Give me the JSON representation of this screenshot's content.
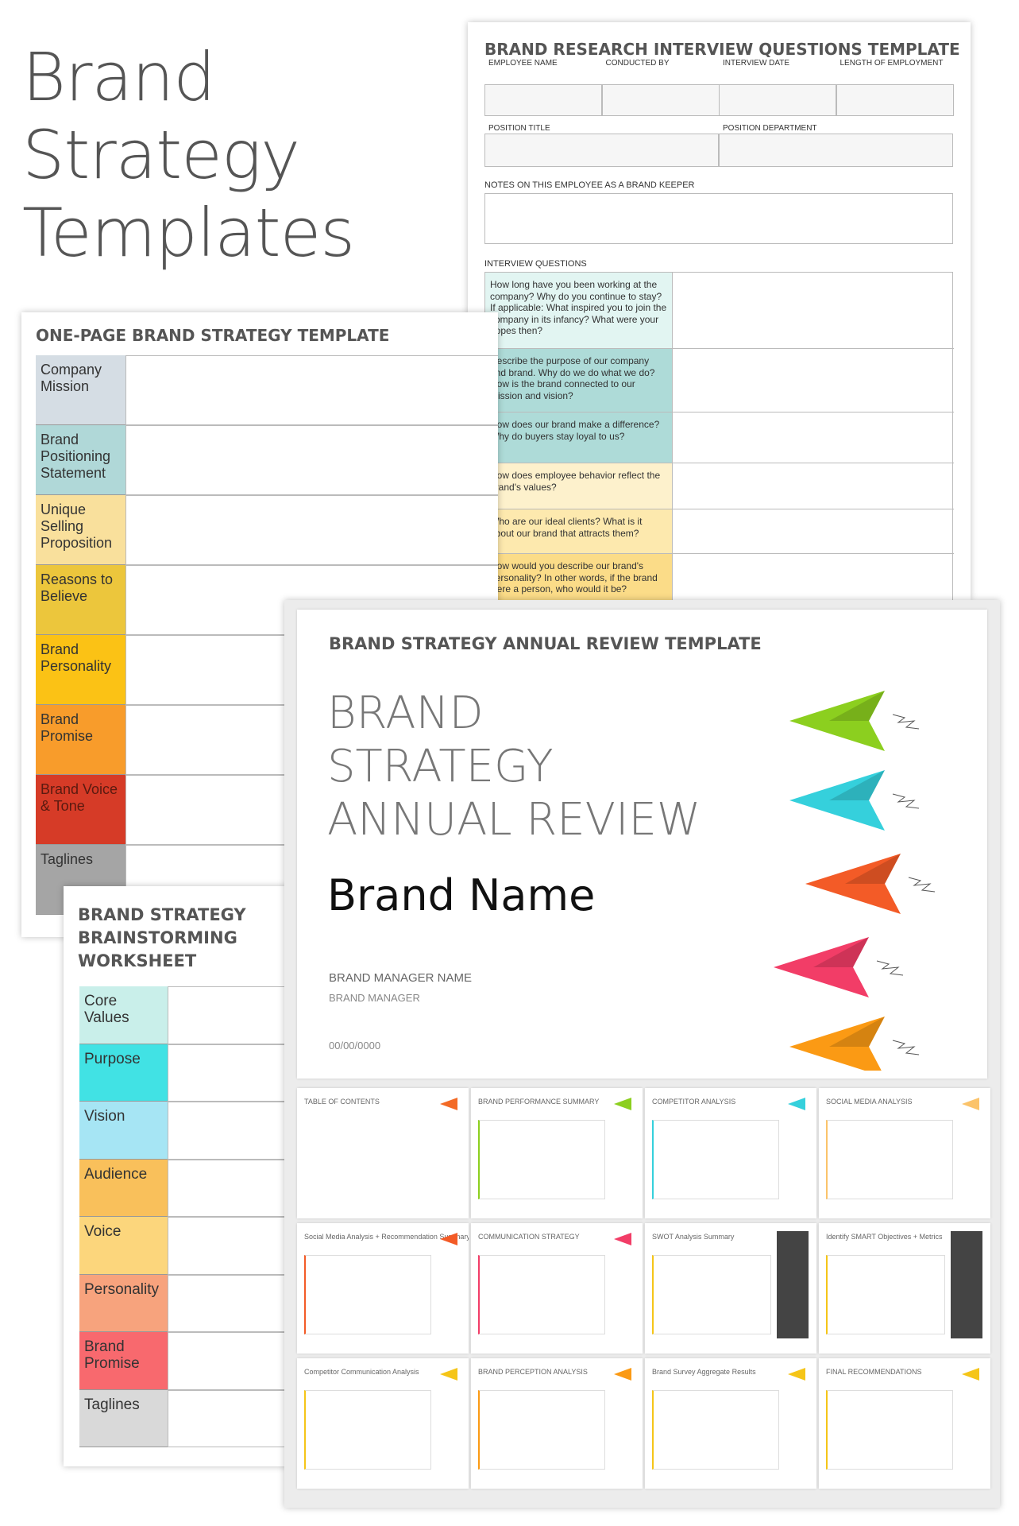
{
  "hero": {
    "line1": "Brand",
    "line2": "Strategy",
    "line3": "Templates"
  },
  "interview": {
    "title": "BRAND RESEARCH INTERVIEW QUESTIONS TEMPLATE",
    "fields1": [
      "EMPLOYEE NAME",
      "CONDUCTED BY",
      "INTERVIEW DATE",
      "LENGTH OF EMPLOYMENT"
    ],
    "fields2": [
      "POSITION TITLE",
      "POSITION DEPARTMENT"
    ],
    "notes_label": "NOTES ON THIS EMPLOYEE AS A BRAND KEEPER",
    "questions_label": "INTERVIEW QUESTIONS",
    "questions": [
      {
        "text": "How long have you been working at the company? Why do you continue to stay? If applicable: What inspired you to join the company in its infancy? What were your hopes then?",
        "color": "#e2f5f2"
      },
      {
        "text": "Describe the purpose of our company and brand. Why do we do what we do? How is the brand connected to our mission and vision?",
        "color": "#aedbd8"
      },
      {
        "text": "How does our brand make a difference? Why do buyers stay loyal to us?",
        "color": "#aedbd8"
      },
      {
        "text": "How does employee behavior reflect the brand's values?",
        "color": "#fdf1cc"
      },
      {
        "text": "Who are our ideal clients? What is it about our brand that attracts them?",
        "color": "#fde9ae"
      },
      {
        "text": "How would you describe our brand's personality? In other words, if the brand were a person, who would it be?",
        "color": "#fbdc88"
      }
    ]
  },
  "onepage": {
    "title": "ONE-PAGE BRAND STRATEGY TEMPLATE",
    "rows": [
      {
        "label": "Company Mission",
        "color": "#d5dde4"
      },
      {
        "label": "Brand Positioning Statement",
        "color": "#b0d8d8"
      },
      {
        "label": "Unique Selling Proposition",
        "color": "#f9e09c"
      },
      {
        "label": "Reasons to Believe",
        "color": "#ecc63c"
      },
      {
        "label": "Brand Personality",
        "color": "#fbc215"
      },
      {
        "label": "Brand Promise",
        "color": "#f89c2b"
      },
      {
        "label": "Brand Voice & Tone",
        "color": "#d63b27"
      },
      {
        "label": "Taglines",
        "color": "#a5a5a5"
      }
    ]
  },
  "brainstorm": {
    "title": "BRAND STRATEGY BRAINSTORMING WORKSHEET",
    "rows": [
      {
        "label": "Core Values",
        "color": "#c9efea"
      },
      {
        "label": "Purpose",
        "color": "#41e2e4"
      },
      {
        "label": "Vision",
        "color": "#a6e5f4"
      },
      {
        "label": "Audience",
        "color": "#f9c05b"
      },
      {
        "label": "Voice",
        "color": "#fcd67c"
      },
      {
        "label": "Personality",
        "color": "#f7a37d"
      },
      {
        "label": "Brand Promise",
        "color": "#f8696e"
      },
      {
        "label": "Taglines",
        "color": "#d9d9d9"
      }
    ]
  },
  "review": {
    "header": "BRAND STRATEGY ANNUAL REVIEW TEMPLATE",
    "big1": "BRAND",
    "big2": "STRATEGY",
    "big3": "ANNUAL REVIEW",
    "brand_name": "Brand Name",
    "manager_name": "BRAND MANAGER NAME",
    "manager_role": "BRAND MANAGER",
    "date": "00/00/0000",
    "plane_colors": [
      "#8ccf1f",
      "#35d0dc",
      "#f35b27",
      "#f23d67",
      "#fb9a14"
    ],
    "pages": [
      {
        "title": "TABLE OF CONTENTS",
        "accent": "#f36a25"
      },
      {
        "title": "BRAND PERFORMANCE SUMMARY",
        "accent": "#8ccf1f"
      },
      {
        "title": "COMPETITOR ANALYSIS",
        "accent": "#35d0dc"
      },
      {
        "title": "SOCIAL MEDIA ANALYSIS",
        "accent": "#fbc36a"
      },
      {
        "title": "Social Media Analysis + Recommendation Summary",
        "accent": "#f35b27"
      },
      {
        "title": "COMMUNICATION STRATEGY",
        "accent": "#f23d67"
      },
      {
        "title": "SWOT Analysis Summary",
        "accent": "#f5c518"
      },
      {
        "title": "Identify SMART Objectives + Metrics",
        "accent": "#f5c518"
      },
      {
        "title": "Competitor Communication Analysis",
        "accent": "#f5c518"
      },
      {
        "title": "BRAND PERCEPTION ANALYSIS",
        "accent": "#fb9a14"
      },
      {
        "title": "Brand Survey Aggregate Results",
        "accent": "#f5c518"
      },
      {
        "title": "FINAL RECOMMENDATIONS",
        "accent": "#f5c518"
      }
    ]
  }
}
